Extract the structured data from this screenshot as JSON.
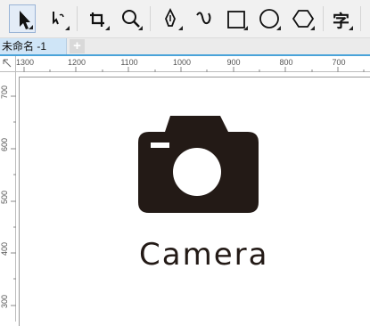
{
  "app": {
    "document_tab": "未命名 -1",
    "add_tab": "+"
  },
  "toolbar": {
    "tools": [
      "pick-tool",
      "freehand-pick-tool",
      "crop-tool",
      "zoom-tool",
      "pen-tool",
      "curve-tool",
      "rectangle-tool",
      "ellipse-tool",
      "polygon-tool",
      "text-tool"
    ],
    "text_tool_glyph": "字",
    "active_tool": "pick-tool"
  },
  "rulers": {
    "horizontal": [
      "1300",
      "1200",
      "1100",
      "1000",
      "900",
      "800",
      "700"
    ],
    "vertical": [
      "700",
      "600",
      "500",
      "400",
      "300"
    ]
  },
  "canvas": {
    "caption": "Camera",
    "icon": "camera-icon",
    "icon_color": "#231a16"
  },
  "colors": {
    "accent": "#4aa3d9",
    "tab_background": "#cfe5f7"
  }
}
